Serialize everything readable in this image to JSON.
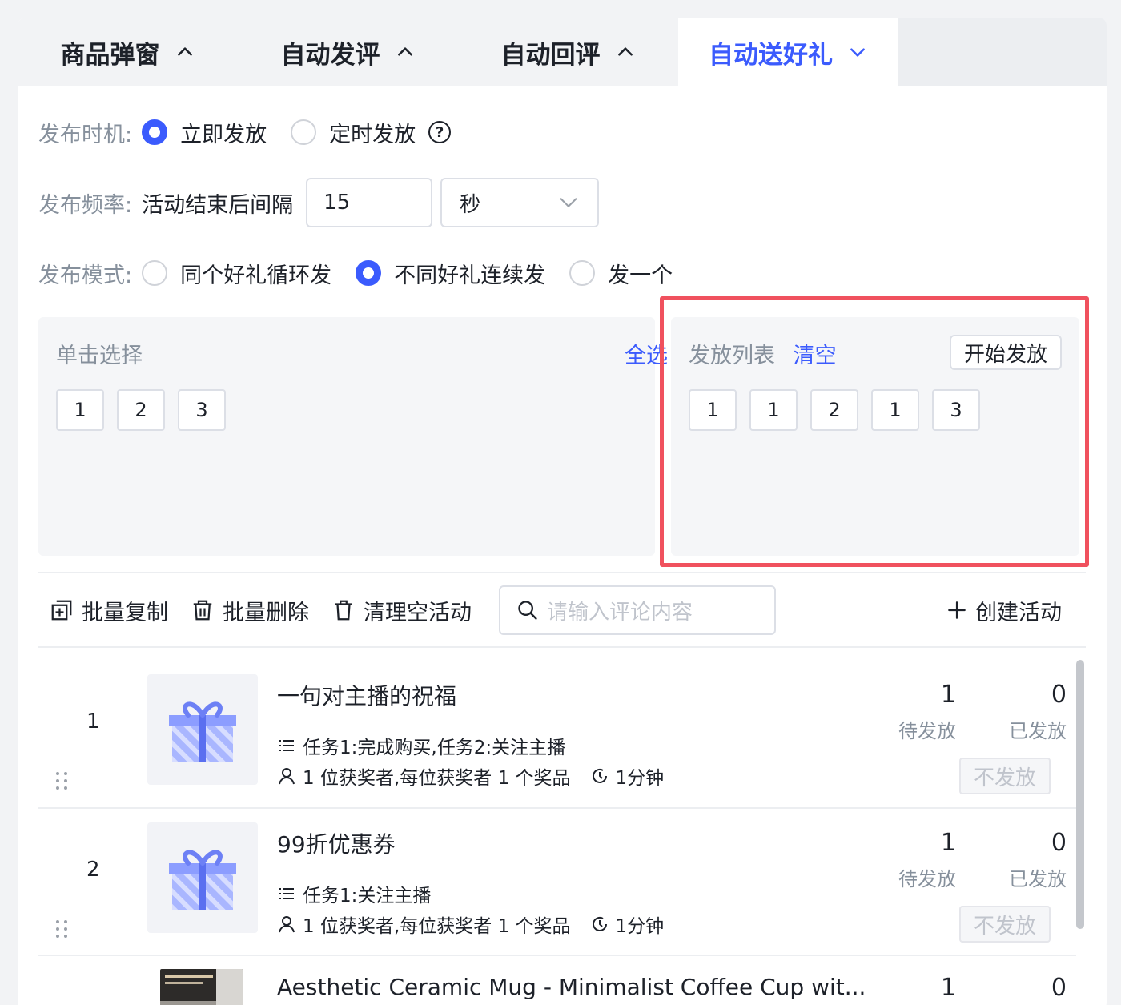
{
  "tabs": [
    {
      "label": "商品弹窗",
      "chevron": "up"
    },
    {
      "label": "自动发评",
      "chevron": "up"
    },
    {
      "label": "自动回评",
      "chevron": "up"
    },
    {
      "label": "自动送好礼",
      "chevron": "down",
      "active": true
    }
  ],
  "timing": {
    "label": "发布时机:",
    "options": [
      "立即发放",
      "定时发放"
    ],
    "selected": "立即发放",
    "help": "?"
  },
  "frequency": {
    "label": "发布频率:",
    "text": "活动结束后间隔",
    "value": "15",
    "unit": "秒"
  },
  "mode": {
    "label": "发布模式:",
    "options": [
      "同个好礼循环发",
      "不同好礼连续发",
      "发一个"
    ],
    "selected": "不同好礼连续发"
  },
  "select_panel": {
    "title": "单击选择",
    "select_all": "全选",
    "chips": [
      "1",
      "2",
      "3"
    ]
  },
  "send_panel": {
    "title": "发放列表",
    "clear": "清空",
    "start": "开始发放",
    "chips": [
      "1",
      "1",
      "2",
      "1",
      "3"
    ]
  },
  "toolbar": {
    "batch_copy": "批量复制",
    "batch_delete": "批量删除",
    "clear_empty": "清理空活动",
    "search_placeholder": "请输入评论内容",
    "create": "创建活动"
  },
  "items": [
    {
      "num": "1",
      "title": "一句对主播的祝福",
      "tasks": "任务1:完成购买,任务2:关注主播",
      "winners": "1 位获奖者,每位获奖者 1 个奖品",
      "duration": "1分钟",
      "pending": "1",
      "pending_label": "待发放",
      "sent": "0",
      "sent_label": "已发放",
      "action": "不发放"
    },
    {
      "num": "2",
      "title": "99折优惠券",
      "tasks": "任务1:关注主播",
      "winners": "1 位获奖者,每位获奖者 1 个奖品",
      "duration": "1分钟",
      "pending": "1",
      "pending_label": "待发放",
      "sent": "0",
      "sent_label": "已发放",
      "action": "不发放"
    },
    {
      "title": "Aesthetic Ceramic Mug - Minimalist Coffee Cup wit...",
      "pending": "1",
      "sent": "0"
    }
  ],
  "colors": {
    "accent": "#3b5bfd",
    "highlight": "#f0515e"
  }
}
